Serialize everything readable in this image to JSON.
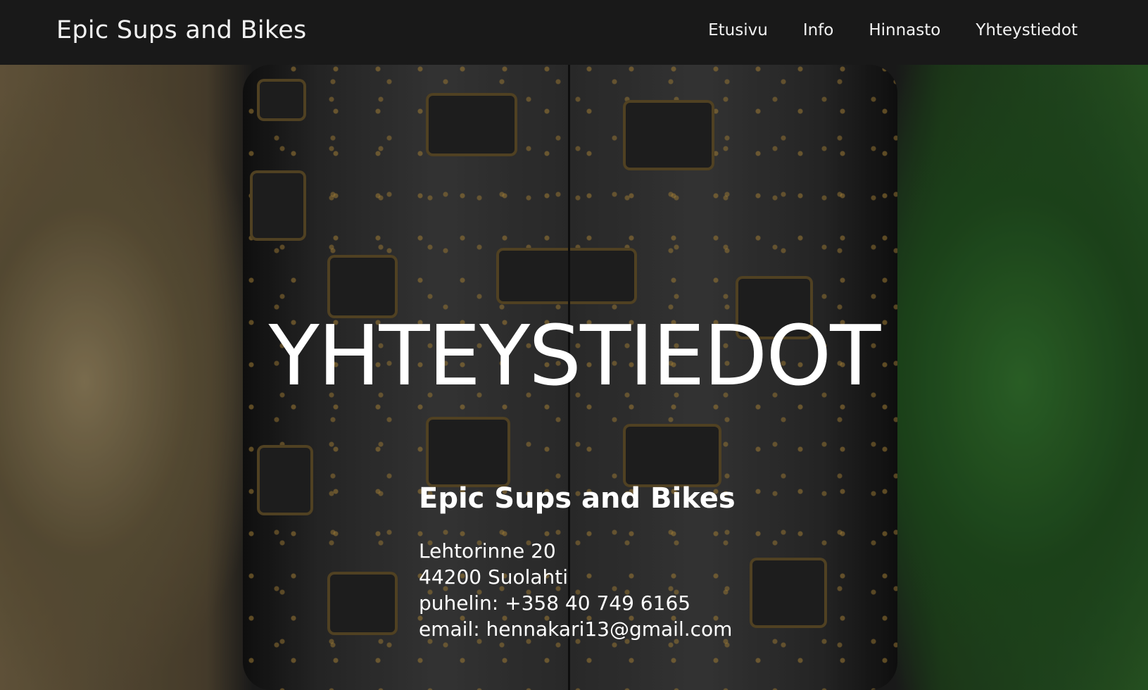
{
  "header": {
    "brand": "Epic Sups and Bikes",
    "nav": [
      {
        "label": "Etusivu"
      },
      {
        "label": "Info"
      },
      {
        "label": "Hinnasto"
      },
      {
        "label": "Yhteystiedot"
      }
    ]
  },
  "hero": {
    "title": "YHTEYSTIEDOT",
    "company": "Epic Sups and Bikes",
    "address_line1": "Lehtorinne 20",
    "address_line2": "44200 Suolahti",
    "phone": "puhelin: +358 40 749 6165",
    "email": "email: hennakari13@gmail.com"
  },
  "colors": {
    "navbar_bg": "#191919",
    "text": "#ffffff"
  }
}
